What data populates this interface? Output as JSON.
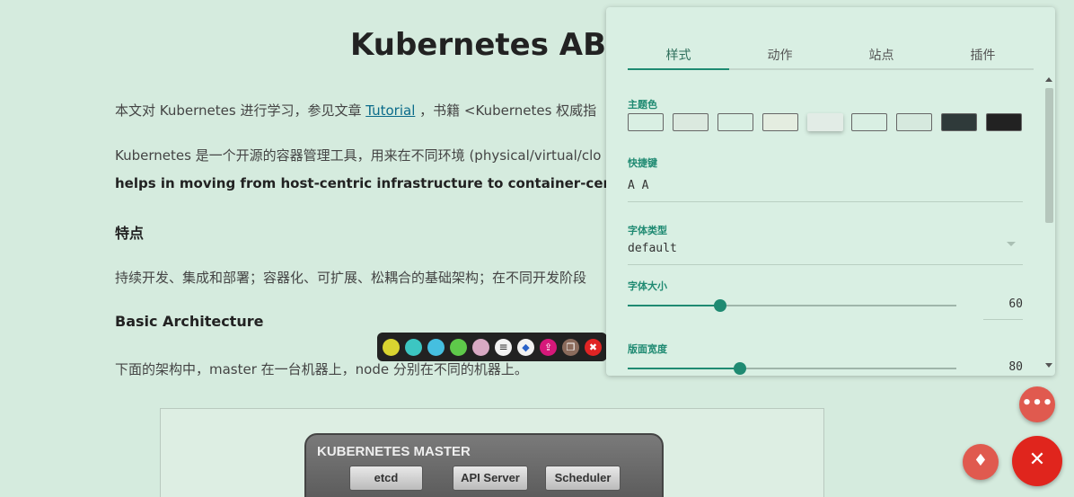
{
  "article": {
    "title": "Kubernetes ABC",
    "p1_prefix": "本文对 Kubernetes 进行学习，参见文章 ",
    "p1_link": "Tutorial",
    "p1_suffix": " ，书籍 <Kubernetes 权威指",
    "p2": "Kubernetes 是一个开源的容器管理工具，用来在不同环境 (physical/virtual/clo",
    "p3": "helps in moving from host-centric infrastructure to container-centric",
    "h1": "特点",
    "p4": "持续开发、集成和部署；容器化、可扩展、松耦合的基础架构；在不同开发阶段",
    "h2": "Basic Architecture",
    "p5": "下面的架构中，master 在一台机器上，node 分别在不同的机器上。",
    "diagram": {
      "master_title": "KUBERNETES MASTER",
      "boxes": [
        "etcd",
        "API Server",
        "Scheduler"
      ]
    }
  },
  "toolbar": {
    "colors": [
      "#d9d430",
      "#3cc6c2",
      "#45bfe0",
      "#5ec94a",
      "#d8a9c3"
    ],
    "icons": [
      "note-icon",
      "tag-icon",
      "export-icon",
      "copy-icon",
      "close-icon"
    ]
  },
  "panel": {
    "tabs": [
      "样式",
      "动作",
      "站点",
      "插件"
    ],
    "theme_label": "主题色",
    "theme_colors": [
      "#d9efe3",
      "#dbe9df",
      "#d9efe3",
      "#e4ede0",
      "#e2ece6",
      "#d9efe3",
      "#d6e9de",
      "#2f3a3a",
      "#222222"
    ],
    "shortcut_label": "快捷键",
    "shortcut_value": "A A",
    "font_type_label": "字体类型",
    "font_type_value": "default",
    "font_size_label": "字体大小",
    "font_size_value": "60",
    "layout_width_label": "版面宽度",
    "layout_width_value": "80"
  },
  "fabs": {
    "more": "more-icon",
    "flashlight": "flashlight-icon",
    "close": "close-icon"
  }
}
